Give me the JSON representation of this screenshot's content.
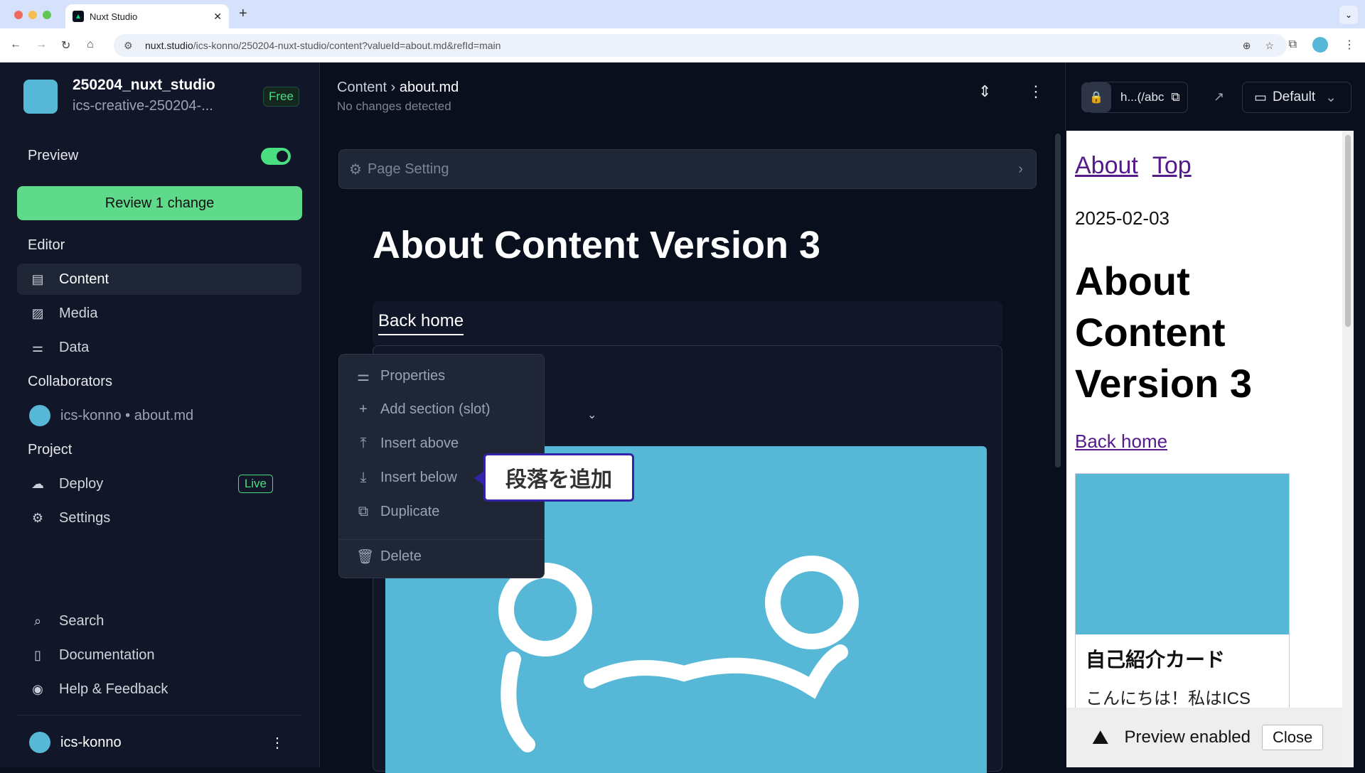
{
  "browser": {
    "tab_title": "Nuxt Studio",
    "url_host": "nuxt.studio",
    "url_path": "/ics-konno/250204-nuxt-studio/content?valueId=about.md&refId=main"
  },
  "sidebar": {
    "project_name": "250204_nuxt_studio",
    "project_sub": "ics-creative-250204-...",
    "plan_badge": "Free",
    "preview_label": "Preview",
    "preview_on": true,
    "review_button": "Review 1 change",
    "editor_heading": "Editor",
    "editor_items": [
      {
        "label": "Content",
        "icon": "files-icon",
        "active": true
      },
      {
        "label": "Media",
        "icon": "image-icon"
      },
      {
        "label": "Data",
        "icon": "sliders-icon"
      }
    ],
    "collaborators_heading": "Collaborators",
    "collaborator": "ics-konno • about.md",
    "project_heading": "Project",
    "project_items": [
      {
        "label": "Deploy",
        "icon": "cloud-icon",
        "badge": "Live"
      },
      {
        "label": "Settings",
        "icon": "gear-icon"
      }
    ],
    "footer_items": [
      {
        "label": "Search",
        "icon": "search-icon"
      },
      {
        "label": "Documentation",
        "icon": "book-icon"
      },
      {
        "label": "Help & Feedback",
        "icon": "discord-icon"
      }
    ],
    "user": "ics-konno"
  },
  "main": {
    "breadcrumb_root": "Content",
    "breadcrumb_file": "about.md",
    "status": "No changes detected",
    "page_setting": "Page Setting",
    "title": "About Content Version 3",
    "back_link": "Back home",
    "context_menu": [
      "Properties",
      "Add section (slot)",
      "Insert above",
      "Insert below",
      "Duplicate",
      "Delete"
    ],
    "callout": "段落を追加"
  },
  "preview_panel": {
    "url_text": "h...(/abc",
    "device": "Default",
    "links": [
      "About",
      "Top"
    ],
    "date": "2025-02-03",
    "title": "About Content Version 3",
    "back_link": "Back home",
    "card_title": "自己紹介カード",
    "card_text": "こんにちは！私はICS",
    "banner_text": "Preview enabled",
    "banner_close": "Close"
  }
}
